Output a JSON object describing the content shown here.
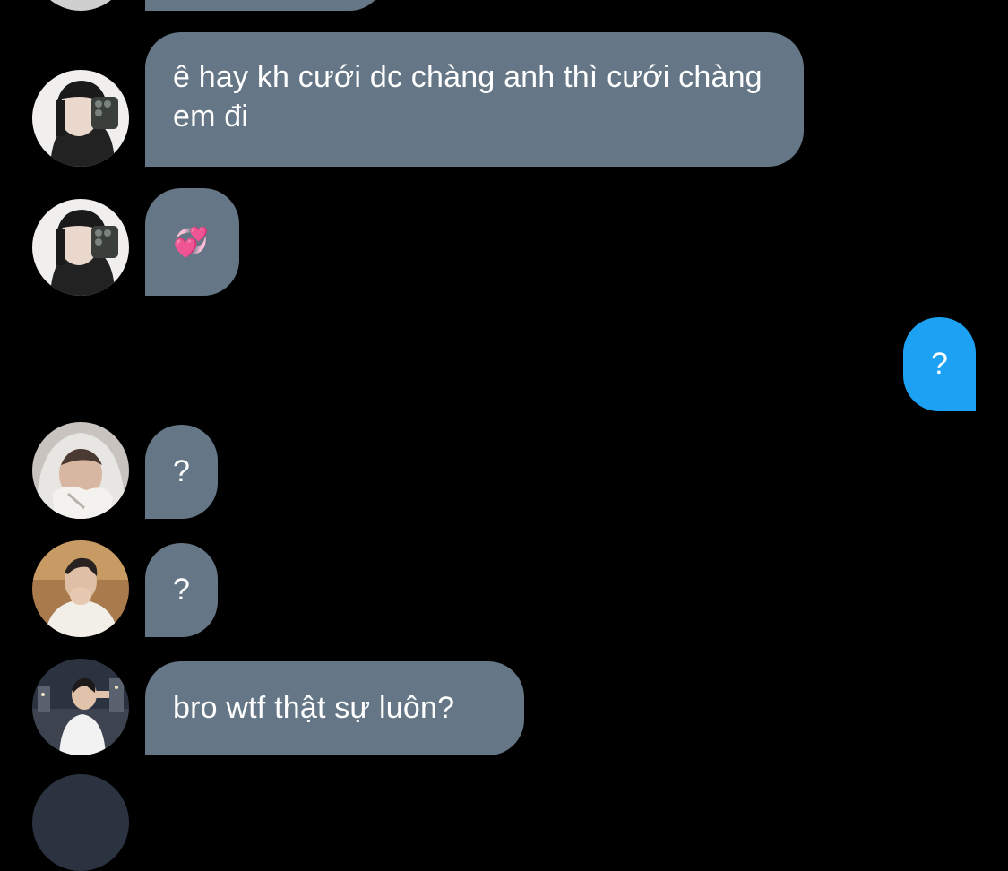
{
  "conversation": {
    "messages": [
      {
        "sender": "girl-mirror-selfie",
        "text": "ê hay kh cưới dc chàng anh thì cưới chàng em đi"
      },
      {
        "sender": "girl-mirror-selfie",
        "text": "💞"
      },
      {
        "sender": "me",
        "text": "?"
      },
      {
        "sender": "boy-hoodie",
        "text": "?"
      },
      {
        "sender": "boy-sweater",
        "text": "?"
      },
      {
        "sender": "boy-night-city",
        "text": "bro wtf thật sự luôn?"
      }
    ]
  },
  "colors": {
    "background": "#000000",
    "incoming_bubble": "#657786",
    "outgoing_bubble": "#1da1f2",
    "text": "#ffffff"
  }
}
